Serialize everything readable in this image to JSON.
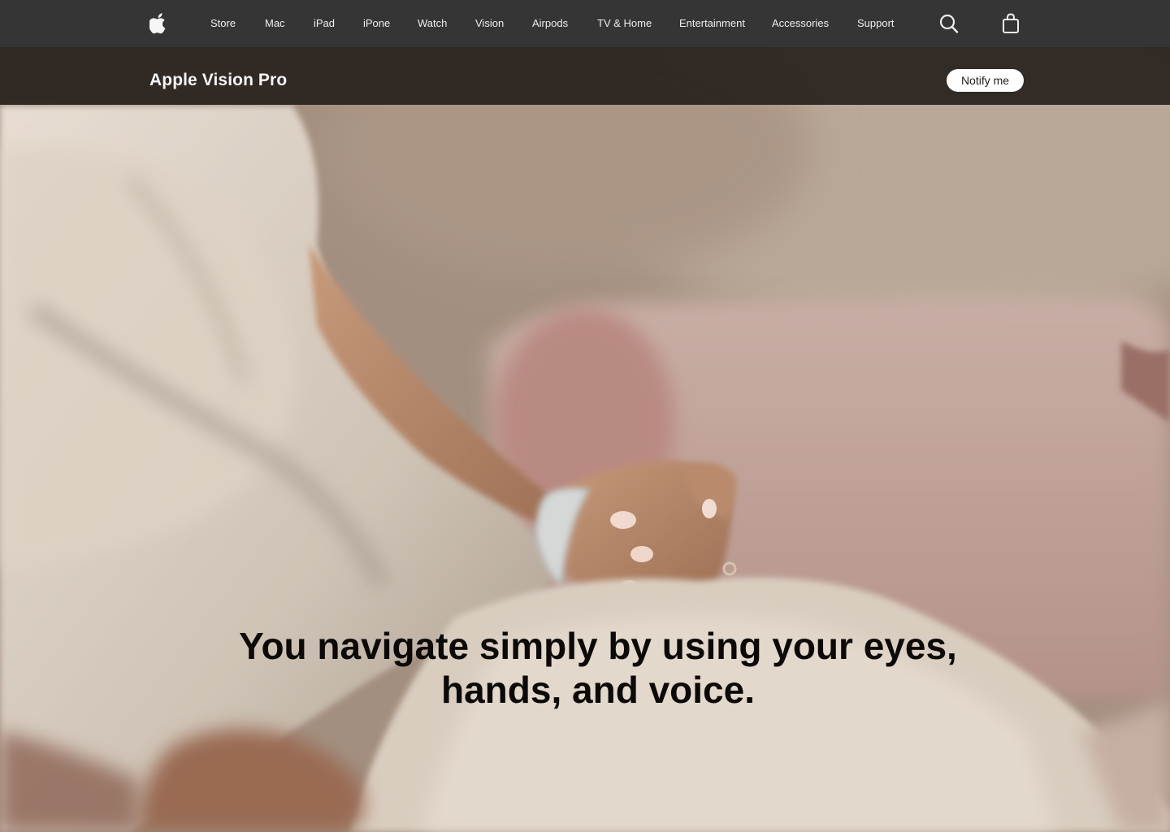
{
  "colors": {
    "global_nav_bg": "#353535",
    "local_nav_bg": "#28211d",
    "nav_text": "#eeeeee",
    "button_bg": "#ffffff",
    "button_text": "#1d1d1f",
    "headline_text": "#0c0a09"
  },
  "global_nav": {
    "logo": "apple-logo-icon",
    "items": [
      {
        "label": "Store"
      },
      {
        "label": "Mac"
      },
      {
        "label": "iPad"
      },
      {
        "label": "iPone"
      },
      {
        "label": "Watch"
      },
      {
        "label": "Vision"
      },
      {
        "label": "Airpods"
      },
      {
        "label": "TV & Home"
      },
      {
        "label": "Entertainment"
      },
      {
        "label": "Accessories"
      },
      {
        "label": "Support"
      }
    ],
    "search_icon": "search-icon",
    "bag_icon": "shopping-bag-icon"
  },
  "local_nav": {
    "title": "Apple Vision Pro",
    "cta_label": "Notify me"
  },
  "hero": {
    "headline_line1": "You navigate simply by using your eyes,",
    "headline_line2": "hands, and voice."
  }
}
